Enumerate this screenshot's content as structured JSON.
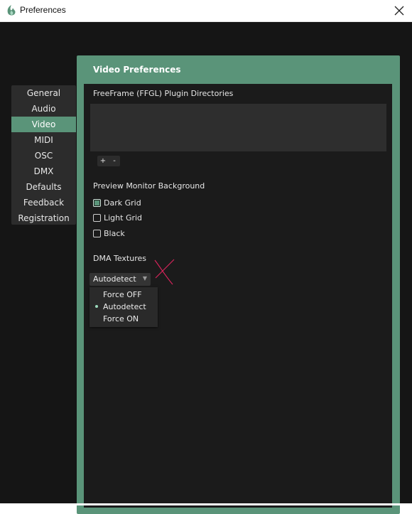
{
  "window": {
    "title": "Preferences"
  },
  "sidebar": {
    "items": [
      {
        "label": "General",
        "active": false
      },
      {
        "label": "Audio",
        "active": false
      },
      {
        "label": "Video",
        "active": true
      },
      {
        "label": "MIDI",
        "active": false
      },
      {
        "label": "OSC",
        "active": false
      },
      {
        "label": "DMX",
        "active": false
      },
      {
        "label": "Defaults",
        "active": false
      },
      {
        "label": "Feedback",
        "active": false
      },
      {
        "label": "Registration",
        "active": false
      }
    ]
  },
  "panel": {
    "title": "Video Preferences",
    "ffgl": {
      "label": "FreeFrame (FFGL) Plugin Directories",
      "add_label": "+",
      "remove_label": "-"
    },
    "preview_bg": {
      "label": "Preview Monitor Background",
      "options": [
        {
          "label": "Dark Grid",
          "checked": true
        },
        {
          "label": "Light Grid",
          "checked": false
        },
        {
          "label": "Black",
          "checked": false
        }
      ]
    },
    "dma": {
      "label": "DMA Textures",
      "selected": "Autodetect",
      "options": [
        "Force OFF",
        "Autodetect",
        "Force ON"
      ]
    }
  },
  "colors": {
    "accent": "#5a9479",
    "background": "#151515",
    "inner_panel": "#1b1b1b",
    "annotation": "#e0245e"
  },
  "icons": {
    "app": "app-flame-icon",
    "close": "close-icon",
    "caret": "chevron-down-icon",
    "annotation": "red-x-mark"
  }
}
